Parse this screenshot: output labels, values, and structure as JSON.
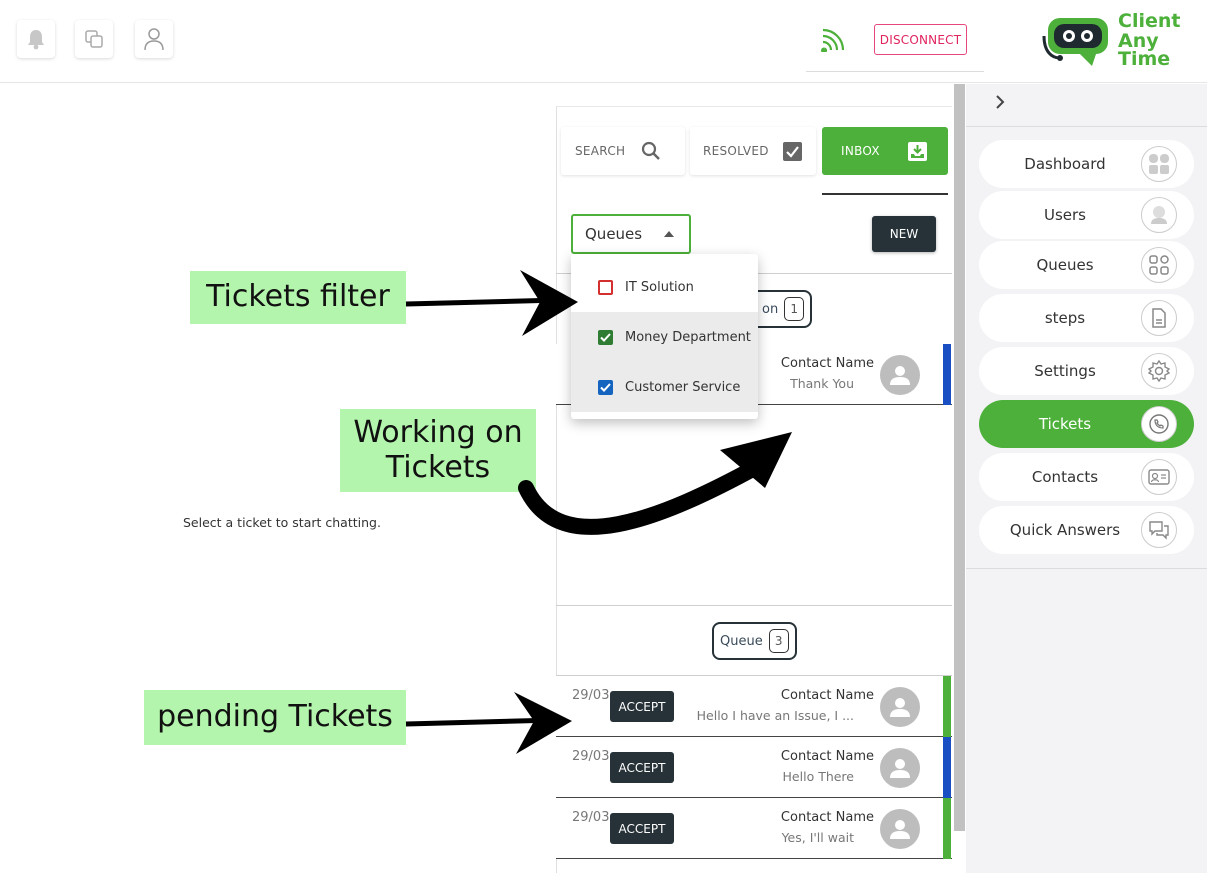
{
  "topbar": {
    "disconnect_label": "DISCONNECT",
    "icons": [
      "bell-icon",
      "copy-icon",
      "user-icon",
      "wifi-icon"
    ],
    "logo": {
      "line1": "Client",
      "line2": "Any",
      "line3": "Time"
    }
  },
  "sidebar": {
    "collapse_icon": "chevron-right-icon",
    "items": [
      {
        "label": "Dashboard",
        "icon": "dashboard-icon",
        "active": false
      },
      {
        "label": "Users",
        "icon": "user-icon",
        "active": false
      },
      {
        "label": "Queues",
        "icon": "grid-icon",
        "active": false
      },
      {
        "label": "steps",
        "icon": "document-icon",
        "active": false
      },
      {
        "label": "Settings",
        "icon": "gear-icon",
        "active": false
      },
      {
        "label": "Tickets",
        "icon": "phone-chat-icon",
        "active": true
      },
      {
        "label": "Contacts",
        "icon": "contact-card-icon",
        "active": false
      },
      {
        "label": "Quick Answers",
        "icon": "chat-bubbles-icon",
        "active": false
      }
    ]
  },
  "tabs": {
    "search": "SEARCH",
    "resolved": "RESOLVED",
    "inbox": "INBOX"
  },
  "filter": {
    "select_label": "Queues",
    "new_label": "NEW",
    "options": [
      {
        "label": "IT Solution",
        "checked": false,
        "color": "#d32f2f"
      },
      {
        "label": "Money Department",
        "checked": true,
        "color": "#2e7d32"
      },
      {
        "label": "Customer Service",
        "checked": true,
        "color": "#1565c0"
      }
    ]
  },
  "working_group": {
    "label_visible": "on",
    "count": "1",
    "tickets": [
      {
        "name": "Contact Name",
        "message": "Thank You",
        "stripe": "#1a4fc4"
      }
    ]
  },
  "queue_group": {
    "label": "Queue",
    "count": "3",
    "tickets": [
      {
        "date": "29/03",
        "accept": "ACCEPT",
        "name": "Contact Name",
        "message": "Hello I have an Issue, I ...",
        "stripe": "#4cb03a"
      },
      {
        "date": "29/03",
        "accept": "ACCEPT",
        "name": "Contact Name",
        "message": "Hello There",
        "stripe": "#1a4fc4"
      },
      {
        "date": "29/03",
        "accept": "ACCEPT",
        "name": "Contact Name",
        "message": "Yes, I'll wait",
        "stripe": "#4cb03a"
      }
    ]
  },
  "empty_message": "Select a ticket to start chatting.",
  "annotations": {
    "tickets_filter": "Tickets filter",
    "working_line1": "Working on",
    "working_line2": "Tickets",
    "pending": "pending Tickets"
  },
  "colors": {
    "brand_green": "#4cb03a",
    "dark_button": "#263238",
    "disconnect": "#e0245e",
    "annotation_bg": "#b3f5ac"
  }
}
